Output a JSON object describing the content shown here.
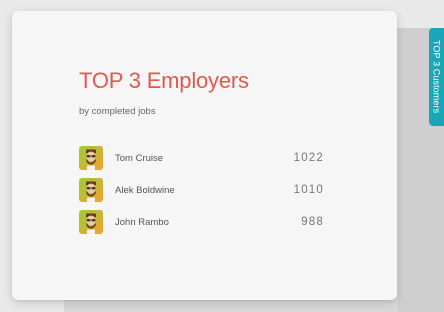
{
  "side_tab": {
    "label": "TOP 3 Customers"
  },
  "card": {
    "title": "TOP 3 Employers",
    "subtitle": "by completed jobs"
  },
  "employers": [
    {
      "name": "Tom Cruise",
      "count": "1022",
      "avatar_icon": "bearded-man-avatar-icon"
    },
    {
      "name": "Alek Boldwine",
      "count": "1010",
      "avatar_icon": "bearded-man-avatar-icon"
    },
    {
      "name": "John Rambo",
      "count": "988",
      "avatar_icon": "bearded-man-avatar-icon"
    }
  ],
  "colors": {
    "title": "#e0594f",
    "tab": "#1ba6b8",
    "avatar_gradient_start": "#9bcd3c",
    "avatar_gradient_end": "#f2a22c"
  }
}
